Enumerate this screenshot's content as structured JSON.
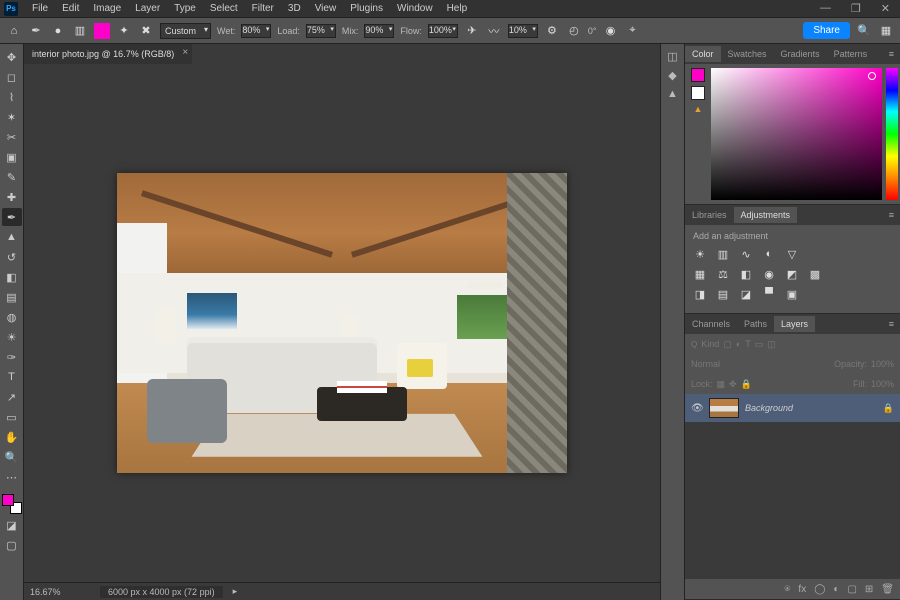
{
  "menu": [
    "File",
    "Edit",
    "Image",
    "Layer",
    "Type",
    "Select",
    "Filter",
    "3D",
    "View",
    "Plugins",
    "Window",
    "Help"
  ],
  "window_controls": {
    "min": "—",
    "max": "❐",
    "close": "✕"
  },
  "options_bar": {
    "preset": "Custom",
    "wet_label": "Wet:",
    "wet": "80%",
    "load_label": "Load:",
    "load": "75%",
    "mix_label": "Mix:",
    "mix": "90%",
    "flow_label": "Flow:",
    "flow": "100%",
    "smoothing": "10%",
    "angle": "0°",
    "share": "Share"
  },
  "document_tab": "interior photo.jpg @ 16.7% (RGB/8)",
  "status": {
    "zoom": "16.67%",
    "info": "6000 px x 4000 px (72 ppi)"
  },
  "color_tabs": [
    "Color",
    "Swatches",
    "Gradients",
    "Patterns"
  ],
  "active_color_tab": "Color",
  "lib_tabs": [
    "Libraries",
    "Adjustments"
  ],
  "active_lib_tab": "Adjustments",
  "adjustments_hint": "Add an adjustment",
  "layer_tabs": [
    "Channels",
    "Paths",
    "Layers"
  ],
  "active_layer_tab": "Layers",
  "layer_controls": {
    "kind": "Kind",
    "blend": "Normal",
    "opacity_label": "Opacity:",
    "opacity": "100%",
    "lock_label": "Lock:",
    "fill_label": "Fill:",
    "fill": "100%"
  },
  "layers": [
    {
      "name": "Background",
      "locked": true,
      "visible": true
    }
  ],
  "foreground_color": "#ff00c8",
  "background_color": "#ffffff"
}
